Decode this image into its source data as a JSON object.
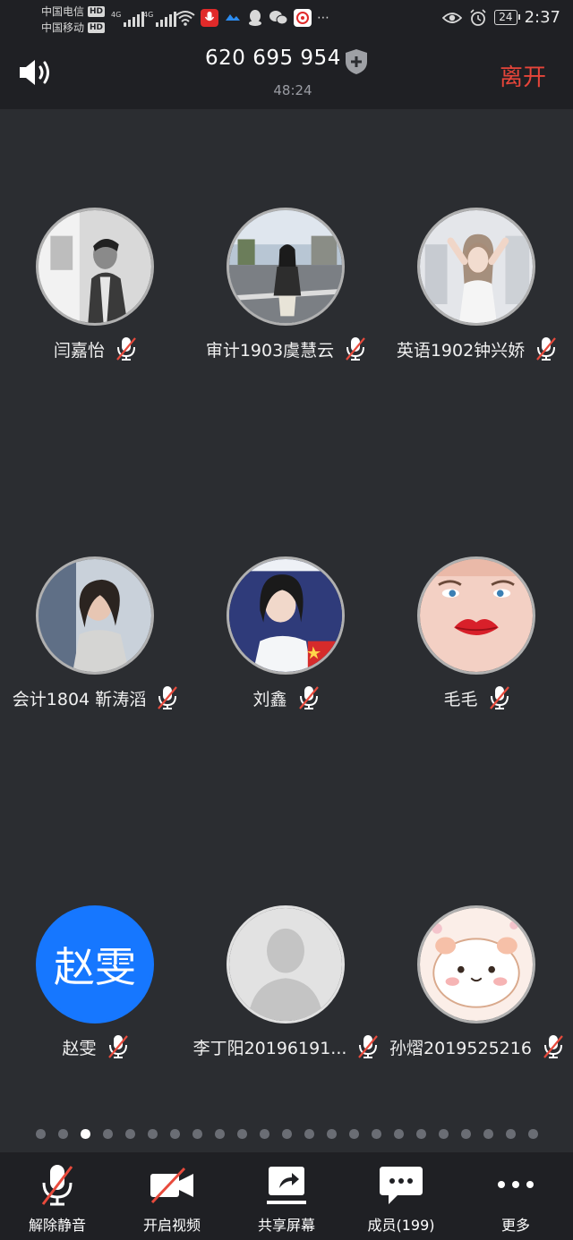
{
  "status_bar": {
    "carrier1": "中国电信",
    "carrier2": "中国移动",
    "hd": "HD",
    "net1": "4G",
    "net2": "4G",
    "battery": "24",
    "time": "2:37",
    "icons": [
      "signal-icon",
      "wifi-icon",
      "recorder-app-icon",
      "cloud-app-icon",
      "qq-icon",
      "wechat-icon",
      "music-app-icon",
      "more-dots-icon",
      "eye-icon",
      "alarm-icon",
      "battery-icon"
    ]
  },
  "header": {
    "meeting_id": "620 695 954",
    "duration": "48:24",
    "leave": "离开"
  },
  "participants": [
    {
      "name": "闫嘉怡",
      "muted": true
    },
    {
      "name": "审计1903虞慧云",
      "muted": true
    },
    {
      "name": "英语1902钟兴娇",
      "muted": true
    },
    {
      "name": "会计1804 靳涛滔",
      "muted": true
    },
    {
      "name": "刘鑫",
      "muted": true
    },
    {
      "name": "毛毛",
      "muted": true
    },
    {
      "name": "赵雯",
      "muted": true,
      "initials": "赵雯"
    },
    {
      "name": "李丁阳20196191...",
      "muted": true
    },
    {
      "name": "孙熠2019525216",
      "muted": true
    }
  ],
  "pagination": {
    "total": 23,
    "current": 3
  },
  "toolbar": {
    "unmute": "解除静音",
    "video": "开启视频",
    "share": "共享屏幕",
    "members": "成员(199)",
    "more": "更多"
  },
  "colors": {
    "leave": "#e6453a",
    "avatar_blue": "#1677ff",
    "mute_red": "#e84a3c",
    "background": "#2b2d31"
  }
}
